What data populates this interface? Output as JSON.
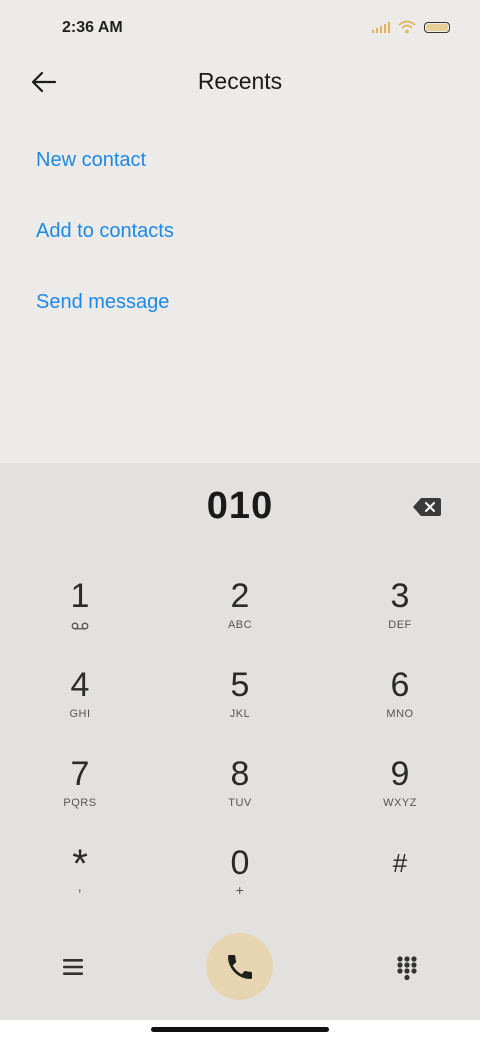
{
  "status_bar": {
    "time": "2:36 AM"
  },
  "header": {
    "title": "Recents"
  },
  "actions": [
    "New contact",
    "Add to contacts",
    "Send message"
  ],
  "dialer": {
    "number": "010",
    "keys": [
      [
        {
          "digit": "1",
          "letters": ""
        },
        {
          "digit": "2",
          "letters": "ABC"
        },
        {
          "digit": "3",
          "letters": "DEF"
        }
      ],
      [
        {
          "digit": "4",
          "letters": "GHI"
        },
        {
          "digit": "5",
          "letters": "JKL"
        },
        {
          "digit": "6",
          "letters": "MNO"
        }
      ],
      [
        {
          "digit": "7",
          "letters": "PQRS"
        },
        {
          "digit": "8",
          "letters": "TUV"
        },
        {
          "digit": "9",
          "letters": "WXYZ"
        }
      ],
      [
        {
          "digit": "*",
          "letters": ","
        },
        {
          "digit": "0",
          "letters": "+"
        },
        {
          "digit": "#",
          "letters": ""
        }
      ]
    ]
  },
  "colors": {
    "accent": "#1e88e5",
    "call_button": "#e6d5b0",
    "dialpad_bg": "#e2e1df",
    "page_bg": "#ecebe9"
  },
  "icons": [
    "back-arrow-icon",
    "backspace-icon",
    "voicemail-icon",
    "menu-icon",
    "phone-icon",
    "dialpad-grid-icon"
  ]
}
